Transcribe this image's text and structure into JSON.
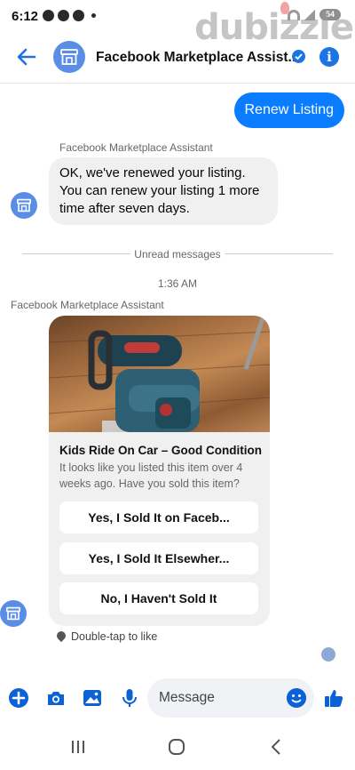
{
  "status_bar": {
    "time": "6:12",
    "battery": "54"
  },
  "watermark": "dubizzle",
  "header": {
    "title": "Facebook Marketplace Assist...",
    "info_label": "i"
  },
  "messages": {
    "sent": "Renew Listing",
    "sender_name_1": "Facebook Marketplace Assistant",
    "received_1": "OK, we've renewed your listing. You can renew your listing 1 more time after seven days.",
    "unread_divider": "Unread messages",
    "timestamp": "1:36 AM",
    "sender_name_2": "Facebook Marketplace Assistant"
  },
  "card": {
    "title": "Kids Ride On Car – Good Condition",
    "body": "It looks like you listed this item over 4 weeks ago. Have you sold this item?",
    "buttons": [
      "Yes, I Sold It on Faceb...",
      "Yes, I Sold It Elsewher...",
      "No, I Haven't Sold It"
    ]
  },
  "reaction_hint": "Double-tap to like",
  "composer": {
    "placeholder": "Message"
  },
  "colors": {
    "accent": "#0a7cff",
    "icon_blue": "#0a62d6",
    "avatar": "#5a8ee6",
    "bubble_gray": "#f0f0f0"
  },
  "icons": [
    "back-arrow-icon",
    "store-icon",
    "verified-icon",
    "info-icon",
    "plus-icon",
    "camera-icon",
    "gallery-icon",
    "microphone-icon",
    "emoji-icon",
    "thumbs-up-icon",
    "heart-icon"
  ]
}
